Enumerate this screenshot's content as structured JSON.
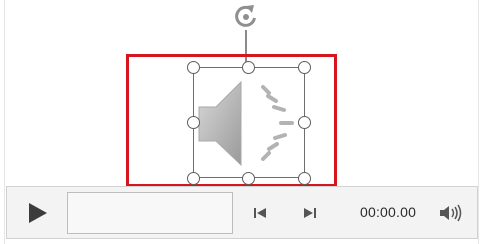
{
  "media_object": {
    "name": "audio-object",
    "icon": "speaker-sound-icon",
    "frame_color": "#d4161e"
  },
  "player": {
    "time": "00:00.00",
    "play_icon": "play-icon",
    "back_icon": "skip-back-icon",
    "forward_icon": "skip-forward-icon",
    "volume_icon": "volume-icon"
  }
}
